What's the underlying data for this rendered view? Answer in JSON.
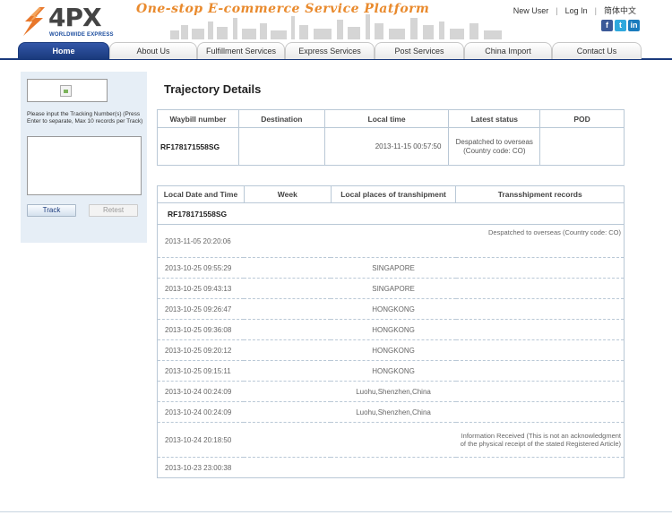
{
  "header": {
    "brand": "4PX",
    "brand_sub": "WORLDWIDE EXPRESS",
    "slogan": "One-stop E-commerce Service Platform",
    "links": {
      "new_user": "New User",
      "log_in": "Log In",
      "chinese": "简体中文"
    },
    "social": [
      {
        "name": "facebook-icon",
        "glyph": "f"
      },
      {
        "name": "twitter-icon",
        "glyph": "t"
      },
      {
        "name": "linkedin-icon",
        "glyph": "in"
      }
    ]
  },
  "nav": {
    "tabs": [
      "Home",
      "About Us",
      "Fulfillment Services",
      "Express Services",
      "Post Services",
      "China Import",
      "Contact Us"
    ],
    "active": "Home"
  },
  "sidebar": {
    "hint": "Please input the Tracking Number(s) (Press Enter to separate, Max 10 records per Track)",
    "textarea_value": "",
    "track_label": "Track",
    "retest_label": "Retest"
  },
  "main": {
    "title": "Trajectory Details",
    "summary": {
      "headers": [
        "Waybill number",
        "Destination",
        "Local time",
        "Latest status",
        "POD"
      ],
      "waybill": "RF178171558SG",
      "destination": "",
      "local_time": "2013-11-15 00:57:50",
      "latest_status": "Despatched to overseas (Country code: CO)",
      "pod": ""
    },
    "details": {
      "headers": [
        "Local Date and Time",
        "Week",
        "Local places of transhipment",
        "Transshipment records"
      ],
      "waybill": "RF178171558SG",
      "rows": [
        {
          "datetime": "2013-11-05 20:20:06",
          "week": "",
          "place": "",
          "record": "Despatched to overseas (Country code: CO)"
        },
        {
          "datetime": "2013-10-25 09:55:29",
          "week": "",
          "place": "SINGAPORE",
          "record": ""
        },
        {
          "datetime": "2013-10-25 09:43:13",
          "week": "",
          "place": "SINGAPORE",
          "record": ""
        },
        {
          "datetime": "2013-10-25 09:26:47",
          "week": "",
          "place": "HONGKONG",
          "record": ""
        },
        {
          "datetime": "2013-10-25 09:36:08",
          "week": "",
          "place": "HONGKONG",
          "record": ""
        },
        {
          "datetime": "2013-10-25 09:20:12",
          "week": "",
          "place": "HONGKONG",
          "record": ""
        },
        {
          "datetime": "2013-10-25 09:15:11",
          "week": "",
          "place": "HONGKONG",
          "record": ""
        },
        {
          "datetime": "2013-10-24 00:24:09",
          "week": "",
          "place": "Luohu,Shenzhen,China",
          "record": ""
        },
        {
          "datetime": "2013-10-24 00:24:09",
          "week": "",
          "place": "Luohu,Shenzhen,China",
          "record": ""
        },
        {
          "datetime": "2013-10-24 20:18:50",
          "week": "",
          "place": "",
          "record": "Information Received (This is not an acknowledgment of the physical receipt of the stated Registered Article)"
        },
        {
          "datetime": "2013-10-23 23:00:38",
          "week": "",
          "place": "",
          "record": ""
        }
      ]
    }
  },
  "colors": {
    "nav_active": "#1a3a7c",
    "slogan": "#e98a2d",
    "border": "#b9c8d6",
    "sidebar_bg": "#e6eef6"
  }
}
